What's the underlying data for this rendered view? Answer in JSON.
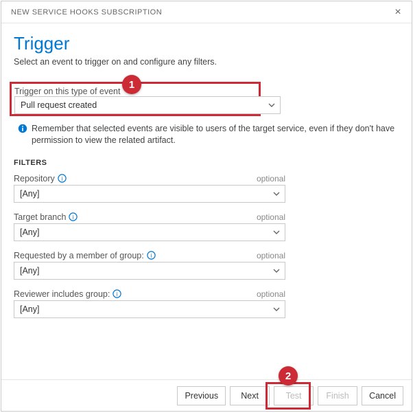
{
  "dialog": {
    "title": "NEW SERVICE HOOKS SUBSCRIPTION",
    "close": "×"
  },
  "page": {
    "title": "Trigger",
    "subtitle": "Select an event to trigger on and configure any filters."
  },
  "event": {
    "label": "Trigger on this type of event",
    "value": "Pull request created"
  },
  "info": {
    "text": "Remember that selected events are visible to users of the target service, even if they don't have permission to view the related artifact."
  },
  "filters": {
    "heading": "FILTERS",
    "items": [
      {
        "label": "Repository",
        "optional": "optional",
        "value": "[Any]",
        "help": true
      },
      {
        "label": "Target branch",
        "optional": "optional",
        "value": "[Any]",
        "help": true
      },
      {
        "label": "Requested by a member of group:",
        "optional": "optional",
        "value": "[Any]",
        "help": true
      },
      {
        "label": "Reviewer includes group:",
        "optional": "optional",
        "value": "[Any]",
        "help": true
      }
    ]
  },
  "footer": {
    "previous": "Previous",
    "next": "Next",
    "test": "Test",
    "finish": "Finish",
    "cancel": "Cancel"
  },
  "annotations": {
    "one": "1",
    "two": "2"
  }
}
